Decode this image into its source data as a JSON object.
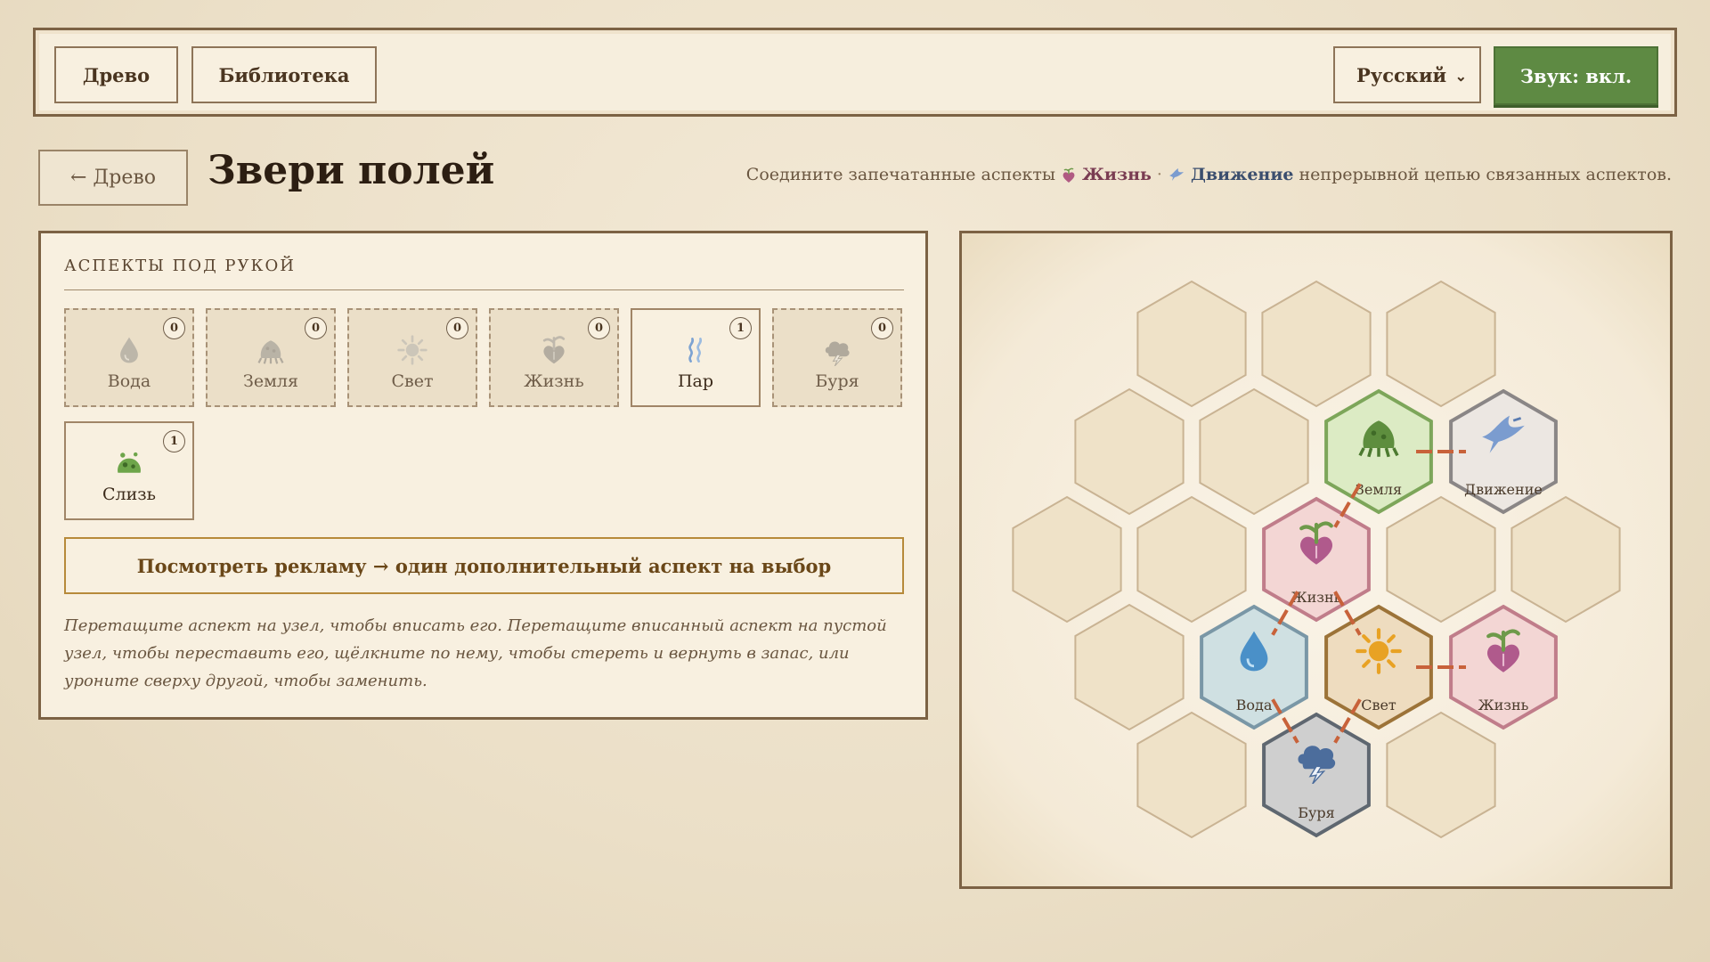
{
  "nav": {
    "tree_label": "Древо",
    "library_label": "Библиотека",
    "language": "Русский",
    "sound_label": "Звук: вкл."
  },
  "header": {
    "back_label": "← Древо",
    "title": "Звери полей",
    "goal_prefix": "Соедините запечатанные аспекты",
    "goal_aspect_1": "Жизнь",
    "goal_separator": "·",
    "goal_aspect_2": "Движение",
    "goal_suffix": "непрерывной цепью связанных аспектов."
  },
  "hand": {
    "title": "АСПЕКТЫ ПОД РУКОЙ",
    "cards": [
      {
        "label": "Вода",
        "count": "0",
        "icon": "water-drop-icon"
      },
      {
        "label": "Земля",
        "count": "0",
        "icon": "earth-mound-icon"
      },
      {
        "label": "Свет",
        "count": "0",
        "icon": "sun-icon"
      },
      {
        "label": "Жизнь",
        "count": "0",
        "icon": "sprout-heart-icon"
      },
      {
        "label": "Пар",
        "count": "1",
        "icon": "steam-icon"
      },
      {
        "label": "Буря",
        "count": "0",
        "icon": "storm-cloud-icon"
      },
      {
        "label": "Слизь",
        "count": "1",
        "icon": "slime-icon"
      }
    ],
    "ad_label": "Посмотреть рекламу → один дополнительный аспект на выбор",
    "hint": "Перетащите аспект на узел, чтобы вписать его. Перетащите вписанный аспект на пустой узел, чтобы переставить его, щёлкните по нему, чтобы стереть и вернуть в запас, или уроните сверху другой, чтобы заменить."
  },
  "board": {
    "filled": [
      {
        "label": "Земля",
        "icon": "earth-mound-icon",
        "fill": "#dcebc4",
        "stroke": "#7da65a"
      },
      {
        "label": "Движение",
        "icon": "bird-icon",
        "fill": "#ece7e2",
        "stroke": "#8a8686"
      },
      {
        "label": "Жизнь",
        "icon": "sprout-heart-icon",
        "fill": "#f3d6d4",
        "stroke": "#c07d8a"
      },
      {
        "label": "Вода",
        "icon": "water-drop-icon",
        "fill": "#cfe0e2",
        "stroke": "#7a97a6"
      },
      {
        "label": "Свет",
        "icon": "sun-icon",
        "fill": "#eedcbf",
        "stroke": "#9c7338"
      },
      {
        "label": "Жизнь",
        "icon": "sprout-heart-icon",
        "fill": "#f3d6d4",
        "stroke": "#c07d8a"
      },
      {
        "label": "Буря",
        "icon": "storm-cloud-icon",
        "fill": "#cfcfcf",
        "stroke": "#5f6770"
      }
    ],
    "colors": {
      "empty_fill": "#efe2c8",
      "empty_stroke": "#c9b393",
      "link": "#c8623a"
    }
  }
}
